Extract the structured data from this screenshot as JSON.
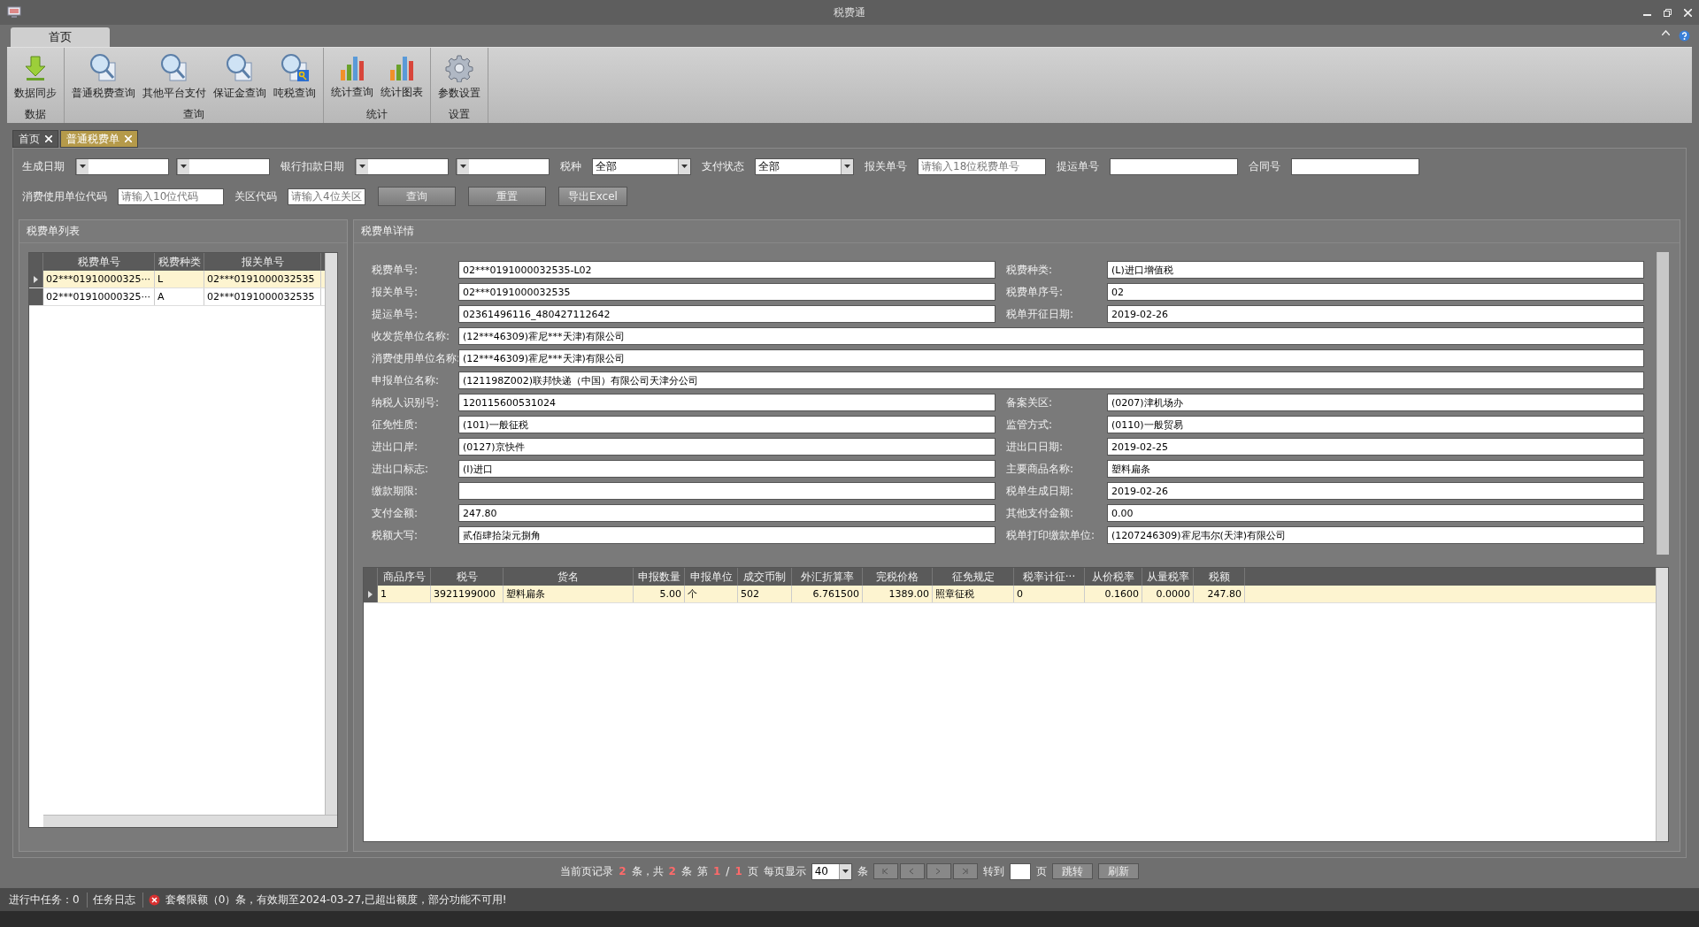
{
  "window": {
    "title": "税费通"
  },
  "ribbon": {
    "tabs": [
      {
        "label": "首页",
        "selected": true
      }
    ],
    "groups": [
      {
        "label": "数据",
        "buttons": [
          "数据同步"
        ]
      },
      {
        "label": "查询",
        "buttons": [
          "普通税费查询",
          "其他平台支付",
          "保证金查询",
          "吨税查询"
        ]
      },
      {
        "label": "统计",
        "buttons": [
          "统计查询",
          "统计图表"
        ]
      },
      {
        "label": "设置",
        "buttons": [
          "参数设置"
        ]
      }
    ]
  },
  "doc_tabs": [
    {
      "label": "首页",
      "selected": false
    },
    {
      "label": "普通税费单",
      "selected": true
    }
  ],
  "filters": [
    [
      {
        "kind": "label",
        "text": "生成日期"
      },
      {
        "kind": "combo"
      },
      {
        "kind": "combo"
      },
      {
        "kind": "label",
        "text": "银行扣款日期"
      },
      {
        "kind": "combo"
      },
      {
        "kind": "combo"
      },
      {
        "kind": "label",
        "text": "税种"
      },
      {
        "kind": "combo",
        "value": "全部"
      },
      {
        "kind": "label",
        "text": "支付状态"
      },
      {
        "kind": "combo",
        "value": "全部"
      },
      {
        "kind": "label",
        "text": "报关单号"
      },
      {
        "kind": "input",
        "placeholder": "请输入18位税费单号"
      },
      {
        "kind": "label",
        "text": "提运单号"
      },
      {
        "kind": "input"
      },
      {
        "kind": "label",
        "text": "合同号"
      },
      {
        "kind": "input"
      }
    ],
    [
      {
        "kind": "label",
        "text": "消费使用单位代码"
      },
      {
        "kind": "input",
        "placeholder": "请输入10位代码"
      },
      {
        "kind": "label",
        "text": "关区代码"
      },
      {
        "kind": "input",
        "placeholder": "请输入4位关区"
      },
      {
        "kind": "button",
        "text": "查询"
      },
      {
        "kind": "button",
        "text": "重置"
      },
      {
        "kind": "button",
        "text": "导出Excel"
      }
    ]
  ],
  "list_panel": {
    "title": "税费单列表",
    "columns": [
      "税费单号",
      "税费种类",
      "报关单号"
    ],
    "rows": [
      {
        "cells": [
          "02***01910000325···",
          "L",
          "02***0191000032535"
        ],
        "selected": true
      },
      {
        "cells": [
          "02***01910000325···",
          "A",
          "02***0191000032535"
        ],
        "selected": false
      }
    ]
  },
  "detail_panel": {
    "title": "税费单详情",
    "rows": [
      {
        "kind": "pair",
        "label": "税费单号:",
        "value": "02***0191000032535-L02",
        "label2": "税费种类:",
        "value2": "(L)进口增值税"
      },
      {
        "kind": "pair",
        "label": "报关单号:",
        "value": "02***0191000032535",
        "label2": "税费单序号:",
        "value2": "02"
      },
      {
        "kind": "pair",
        "label": "提运单号:",
        "value": "02361496116_480427112642",
        "label2": "税单开征日期:",
        "value2": "2019-02-26"
      },
      {
        "kind": "full",
        "label": "收发货单位名称:",
        "value": "(12***46309)霍尼***天津)有限公司"
      },
      {
        "kind": "full",
        "label": "消费使用单位名称:",
        "value": "(12***46309)霍尼***天津)有限公司"
      },
      {
        "kind": "full",
        "label": "申报单位名称:",
        "value": "(121198Z002)联邦快递（中国）有限公司天津分公司"
      },
      {
        "kind": "pair",
        "label": "纳税人识别号:",
        "value": "120115600531024",
        "label2": "备案关区:",
        "value2": "(0207)津机场办"
      },
      {
        "kind": "pair",
        "label": "征免性质:",
        "value": "(101)一般征税",
        "label2": "监管方式:",
        "value2": "(0110)一般贸易"
      },
      {
        "kind": "pair",
        "label": "进出口岸:",
        "value": "(0127)京快件",
        "label2": "进出口日期:",
        "value2": "2019-02-25"
      },
      {
        "kind": "pair",
        "label": "进出口标志:",
        "value": "(I)进口",
        "label2": "主要商品名称:",
        "value2": "塑料扁条"
      },
      {
        "kind": "pair",
        "label": "缴款期限:",
        "label2": "税单生成日期:",
        "value2": "2019-02-26"
      },
      {
        "kind": "pair",
        "label": "支付金额:",
        "value": "247.80",
        "label2": "其他支付金额:",
        "value2": "0.00"
      },
      {
        "kind": "pair",
        "label": "税额大写:",
        "value": "贰佰肆拾柒元捌角",
        "label2": "税单打印缴款单位:",
        "value2": "(1207246309)霍尼韦尔(天津)有限公司"
      }
    ]
  },
  "goods_table": {
    "columns": [
      "商品序号",
      "税号",
      "货名",
      "申报数量",
      "申报单位",
      "成交币制",
      "外汇折算率",
      "完税价格",
      "征免规定",
      "税率计征···",
      "从价税率",
      "从量税率",
      "税额"
    ],
    "rows": [
      {
        "cells": [
          "1",
          "3921199000",
          "塑料扁条",
          "5.00",
          "个",
          "502",
          "6.761500",
          "1389.00",
          "照章征税",
          "0",
          "0.1600",
          "0.0000",
          "247.80"
        ],
        "selected": true
      }
    ]
  },
  "pager": [
    {
      "kind": "text",
      "text": "当前页记录"
    },
    {
      "kind": "count",
      "text": "2"
    },
    {
      "kind": "text",
      "text": "条，共"
    },
    {
      "kind": "count",
      "text": "2"
    },
    {
      "kind": "text",
      "text": "条"
    },
    {
      "kind": "text",
      "text": "第"
    },
    {
      "kind": "count",
      "text": "1"
    },
    {
      "kind": "text",
      "text": "/"
    },
    {
      "kind": "count",
      "text": "1"
    },
    {
      "kind": "text",
      "text": "页"
    },
    {
      "kind": "text",
      "text": "每页显示"
    },
    {
      "kind": "combo",
      "value": "40"
    },
    {
      "kind": "text",
      "text": "条"
    },
    {
      "kind": "nav"
    },
    {
      "kind": "text",
      "text": "转到"
    },
    {
      "kind": "input"
    },
    {
      "kind": "text",
      "text": "页"
    },
    {
      "kind": "button",
      "text": "跳转"
    },
    {
      "kind": "button",
      "text": "刷新"
    }
  ],
  "status_bar": {
    "tasks": "进行中任务：0",
    "log": "任务日志",
    "message": "套餐限额（0）条，有效期至2024-03-27,已超出额度，部分功能不可用!"
  }
}
